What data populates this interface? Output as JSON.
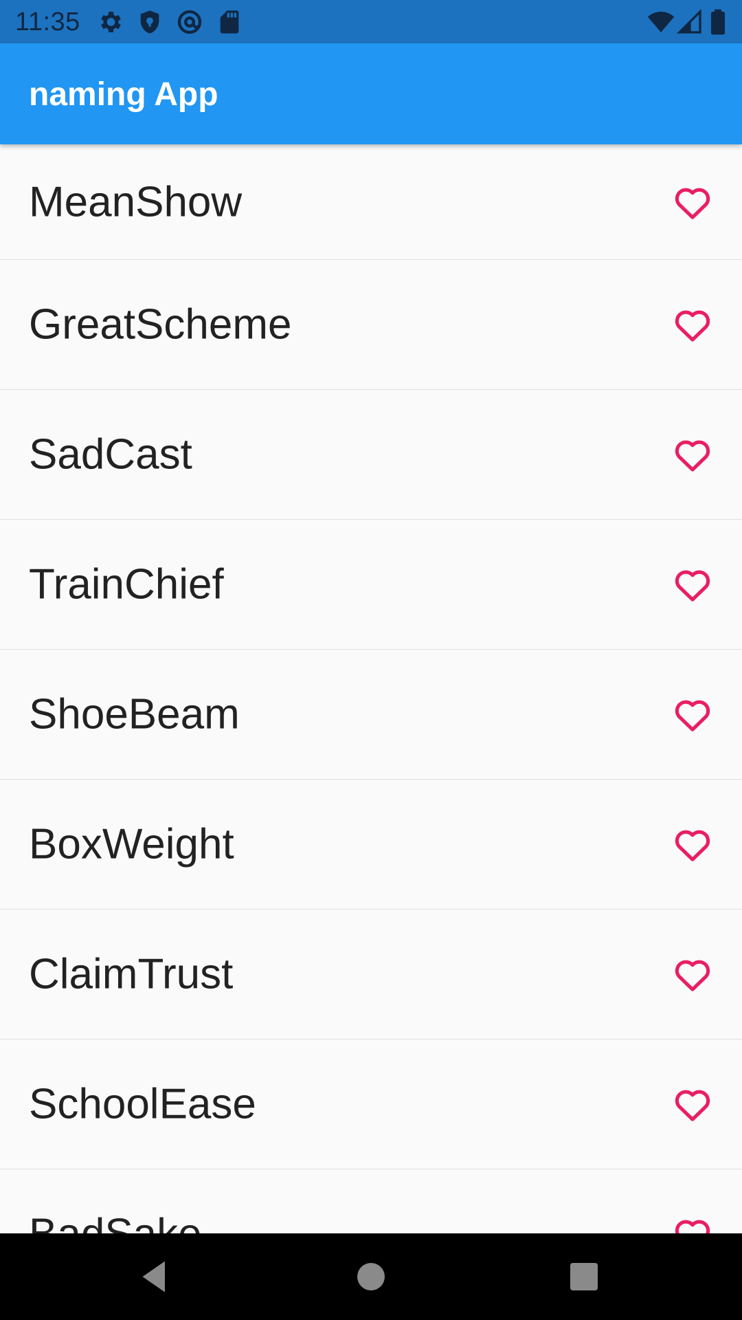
{
  "status_bar": {
    "time": "11:35",
    "icons": [
      "settings-icon",
      "shield-icon",
      "at-sign-icon",
      "sd-card-icon",
      "wifi-icon",
      "cell-signal-icon",
      "battery-icon"
    ]
  },
  "app_bar": {
    "title": "naming App",
    "color": "#2196f3"
  },
  "list": {
    "items": [
      {
        "label": "MeanShow",
        "icon": "heart-outline-icon"
      },
      {
        "label": "GreatScheme",
        "icon": "heart-outline-icon"
      },
      {
        "label": "SadCast",
        "icon": "heart-outline-icon"
      },
      {
        "label": "TrainChief",
        "icon": "heart-outline-icon"
      },
      {
        "label": "ShoeBeam",
        "icon": "heart-outline-icon"
      },
      {
        "label": "BoxWeight",
        "icon": "heart-outline-icon"
      },
      {
        "label": "ClaimTrust",
        "icon": "heart-outline-icon"
      },
      {
        "label": "SchoolEase",
        "icon": "heart-outline-icon"
      },
      {
        "label": "BadSake",
        "icon": "heart-outline-icon"
      }
    ],
    "heart_color": "#e91e63"
  },
  "nav_bar": {
    "buttons": [
      "back-icon",
      "home-icon",
      "recents-icon"
    ]
  }
}
